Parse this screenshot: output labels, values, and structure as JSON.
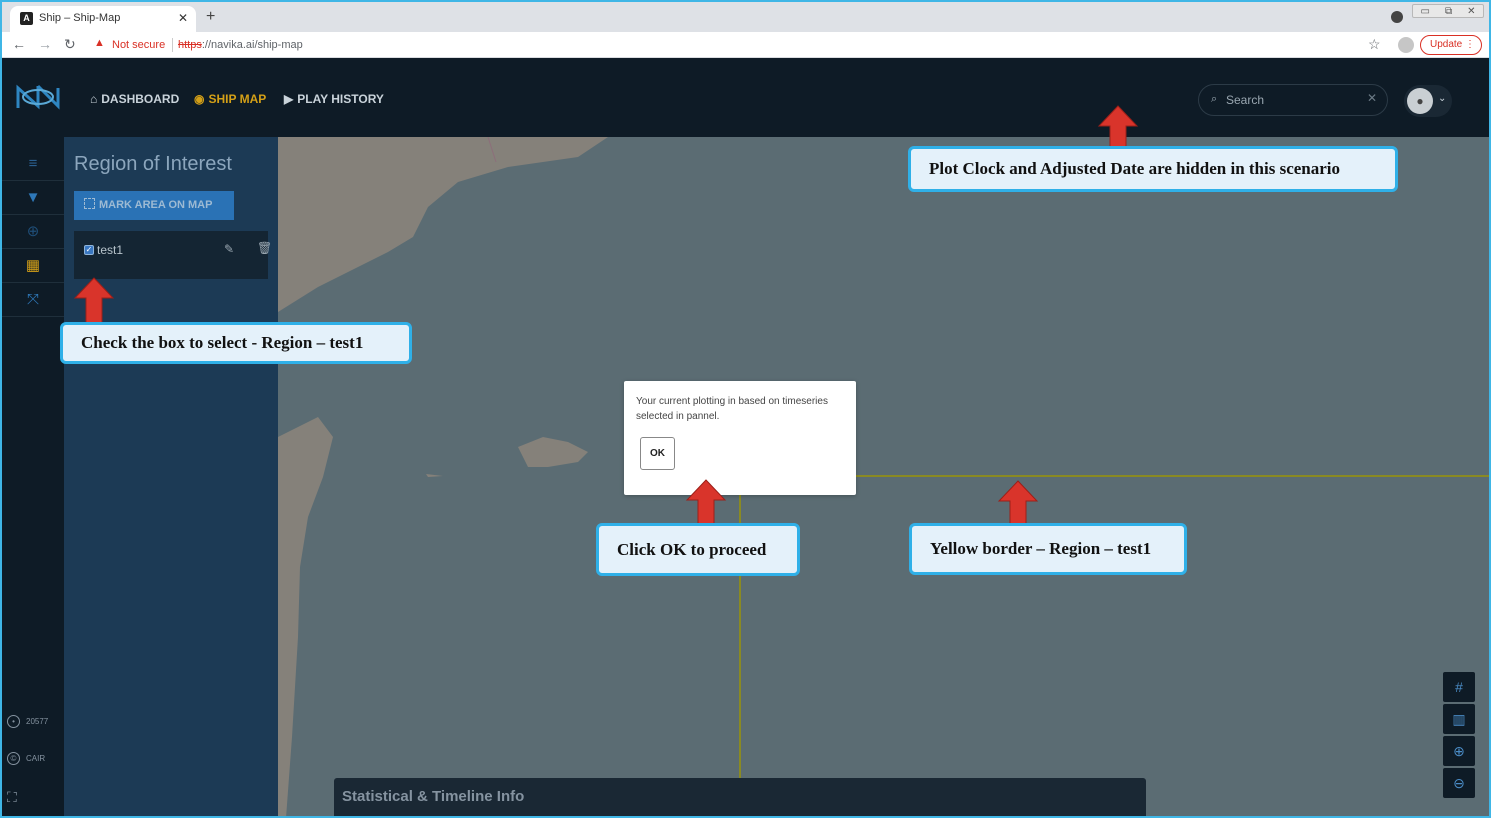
{
  "browser": {
    "tab_title": "Ship – Ship-Map",
    "tab_favicon": "A",
    "not_secure": "Not secure",
    "url_scheme": "https",
    "url_rest": "://navika.ai/ship-map",
    "update_label": "Update"
  },
  "nav": {
    "dashboard": "DASHBOARD",
    "ship_map": "SHIP MAP",
    "play_history": "PLAY HISTORY",
    "search_placeholder": "Search"
  },
  "sidebar": {
    "counter": "20577",
    "cair": "CAIR"
  },
  "panel": {
    "title": "Region of Interest",
    "mark_button": "MARK AREA ON MAP",
    "regions": [
      {
        "label": "test1",
        "checked": true
      }
    ]
  },
  "dialog": {
    "message": "Your current plotting in based on timeseries selected in pannel.",
    "ok_label": "OK"
  },
  "stats": {
    "title": "Statistical & Timeline Info"
  },
  "annotations": {
    "plot_clock": "Plot  Clock and Adjusted Date are hidden  in this scenario",
    "check_box": "Check the box to select  - Region – test1",
    "click_ok": "Click OK to proceed",
    "yellow_border": "Yellow border – Region – test1"
  },
  "colors": {
    "accent_yellow": "#d4a017",
    "nav_bg": "#0e1b26",
    "map_sea": "#5b6c73",
    "callout_border": "#2fb0e8",
    "arrow_red": "#d9342b"
  },
  "icons": {
    "back": "arrow-left-icon",
    "forward": "arrow-right-icon",
    "reload": "reload-icon",
    "home": "home-icon",
    "target": "target-icon",
    "play": "play-icon",
    "search": "search-icon",
    "menu": "menu-icon",
    "filter": "filter-icon",
    "edit": "pencil-icon",
    "delete": "trash-icon"
  }
}
